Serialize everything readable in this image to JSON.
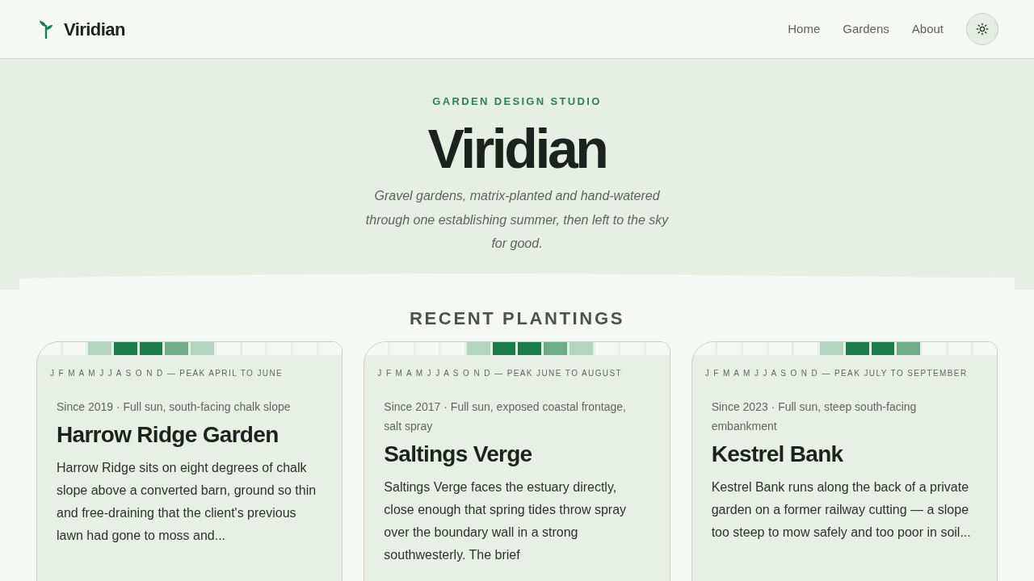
{
  "header": {
    "brand": "Viridian",
    "nav": [
      {
        "label": "Home"
      },
      {
        "label": "Gardens"
      },
      {
        "label": "About"
      }
    ]
  },
  "hero": {
    "eyebrow": "GARDEN DESIGN STUDIO",
    "title": "Viridian",
    "tagline": "Gravel gardens, matrix-planted and hand-watered through one establishing summer, then left to the sky for good."
  },
  "recent": {
    "heading": "RECENT PLANTINGS",
    "gardens": [
      {
        "bloom": [
          {
            "color": "#f6f8f4"
          },
          {
            "color": "#f6f8f4"
          },
          {
            "color": "#b5d5c3"
          },
          {
            "color": "#1e7b4c"
          },
          {
            "color": "#1e7b4c"
          },
          {
            "color": "#6fac8a"
          },
          {
            "color": "#b5d5c3"
          },
          {
            "color": "#f6f8f4"
          },
          {
            "color": "#f6f8f4"
          },
          {
            "color": "#f6f8f4"
          },
          {
            "color": "#f6f8f4"
          },
          {
            "color": "#f6f8f4"
          }
        ],
        "months_label": "J F M A M J J A S O N D — PEAK APRIL TO JUNE",
        "meta": "Since 2019 · Full sun, south-facing chalk slope",
        "title": "Harrow Ridge Garden",
        "description": "Harrow Ridge sits on eight degrees of chalk slope above a converted barn, ground so thin and free-draining that the client's previous lawn had gone to moss and..."
      },
      {
        "bloom": [
          {
            "color": "#f6f8f4"
          },
          {
            "color": "#f6f8f4"
          },
          {
            "color": "#f6f8f4"
          },
          {
            "color": "#f6f8f4"
          },
          {
            "color": "#b5d5c3"
          },
          {
            "color": "#1e7b4c"
          },
          {
            "color": "#1e7b4c"
          },
          {
            "color": "#6fac8a"
          },
          {
            "color": "#b5d5c3"
          },
          {
            "color": "#f6f8f4"
          },
          {
            "color": "#f6f8f4"
          },
          {
            "color": "#f6f8f4"
          }
        ],
        "months_label": "J F M A M J J A S O N D — PEAK JUNE TO AUGUST",
        "meta": "Since 2017 · Full sun, exposed coastal frontage, salt spray",
        "title": "Saltings Verge",
        "description": "Saltings Verge faces the estuary directly, close enough that spring tides throw spray over the boundary wall in a strong southwesterly. The brief"
      },
      {
        "bloom": [
          {
            "color": "#f6f8f4"
          },
          {
            "color": "#f6f8f4"
          },
          {
            "color": "#f6f8f4"
          },
          {
            "color": "#f6f8f4"
          },
          {
            "color": "#f6f8f4"
          },
          {
            "color": "#b5d5c3"
          },
          {
            "color": "#1e7b4c"
          },
          {
            "color": "#1e7b4c"
          },
          {
            "color": "#6fac8a"
          },
          {
            "color": "#f6f8f4"
          },
          {
            "color": "#f6f8f4"
          },
          {
            "color": "#f6f8f4"
          }
        ],
        "months_label": "J F M A M J J A S O N D — PEAK JULY TO SEPTEMBER",
        "meta": "Since 2023 · Full sun, steep south-facing embankment",
        "title": "Kestrel Bank",
        "description": "Kestrel Bank runs along the back of a private garden on a former railway cutting — a slope too steep to mow safely and too poor in soil..."
      }
    ]
  }
}
